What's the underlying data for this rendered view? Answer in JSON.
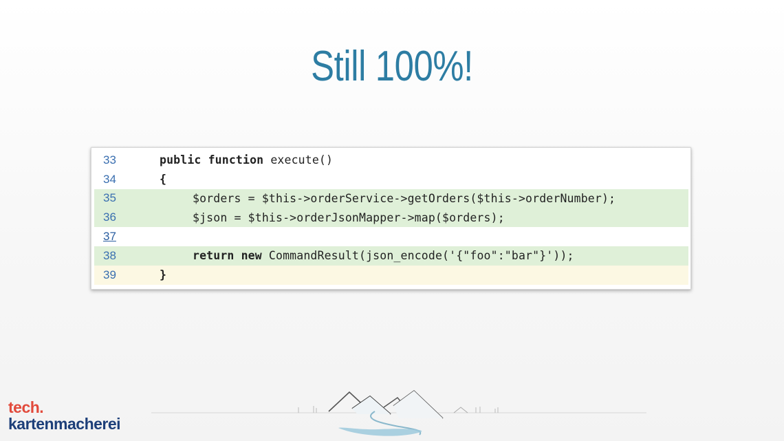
{
  "slide": {
    "title": "Still 100%!"
  },
  "code_view": {
    "lines": [
      {
        "number": "33",
        "status": "none",
        "code": [
          {
            "kw": "public function"
          },
          {
            "t": " execute()"
          }
        ],
        "indent": "    "
      },
      {
        "number": "34",
        "status": "none",
        "code": [
          {
            "kw": "{"
          }
        ],
        "indent": "    "
      },
      {
        "number": "35",
        "status": "covered",
        "code": [
          {
            "t": "$orders = $this->orderService->getOrders($this->orderNumber);"
          }
        ],
        "indent": "        "
      },
      {
        "number": "36",
        "status": "covered",
        "code": [
          {
            "t": "$json = $this->orderJsonMapper->map($orders);"
          }
        ],
        "indent": "        "
      },
      {
        "number": "37",
        "status": "none",
        "code": [],
        "indent": ""
      },
      {
        "number": "38",
        "status": "covered",
        "code": [
          {
            "kw": "return new"
          },
          {
            "t": " CommandResult(json_encode('{\"foo\":\"bar\"}'));"
          }
        ],
        "indent": "        "
      },
      {
        "number": "39",
        "status": "warning",
        "code": [
          {
            "kw": "}"
          }
        ],
        "indent": "    "
      }
    ],
    "colors": {
      "covered": "#dff0d8",
      "warning": "#fcf8e3",
      "line_number": "#3a6fb0"
    }
  },
  "brand": {
    "line1": "tech.",
    "line2": "kartenmacherei",
    "colors": {
      "line1": "#e24a3b",
      "line2": "#1d3f79"
    }
  },
  "decor": {
    "icon": "mountain-landscape-icon"
  }
}
